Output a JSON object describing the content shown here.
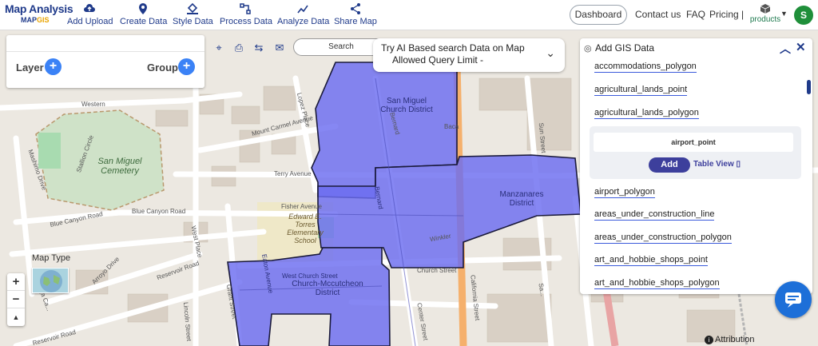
{
  "app": {
    "logo_main": "Map Analysis",
    "logo_sub_a": "MAP",
    "logo_sub_b": "GIS"
  },
  "nav": [
    {
      "label": "Add Upload",
      "icon": "upload-cloud-icon"
    },
    {
      "label": "Create Data",
      "icon": "map-pin-icon"
    },
    {
      "label": "Style Data",
      "icon": "paint-bucket-icon"
    },
    {
      "label": "Process Data",
      "icon": "process-icon"
    },
    {
      "label": "Analyze Data",
      "icon": "analyze-icon"
    },
    {
      "label": "Share Map",
      "icon": "share-icon"
    }
  ],
  "header_right": {
    "dashboard": "Dashboard",
    "contact": "Contact us",
    "faq": "FAQ",
    "pricing": "Pricing |",
    "products": "products",
    "avatar": "S"
  },
  "layer_panel": {
    "layer": "Layer",
    "group": "Group"
  },
  "search": {
    "label": "Search"
  },
  "ai_search": {
    "line1": "Try AI Based search Data on Map",
    "line2": "Allowed Query Limit -"
  },
  "gis_panel": {
    "title": "Add GIS Data",
    "items_top": [
      "accommodations_polygon",
      "agricultural_lands_point",
      "agricultural_lands_polygon"
    ],
    "selected": {
      "name": "airport_point",
      "add": "Add",
      "table_view": "Table View"
    },
    "items_bottom": [
      "airport_polygon",
      "areas_under_construction_line",
      "areas_under_construction_polygon",
      "art_and_hobbie_shops_point",
      "art_and_hobbie_shops_polygon"
    ]
  },
  "map": {
    "map_type": "Map Type",
    "attribution": "Attribution",
    "zoom_in": "+",
    "zoom_out": "−",
    "reset": "▲",
    "streets": [
      "Western",
      "Stallion Circle",
      "Mashimo Drive",
      "Terry Avenue",
      "Fisher Avenue",
      "Blue Canyon Road",
      "Blue Canyon Road",
      "West Place",
      "Reservoir Road",
      "Arroyo Drive",
      "Grant Street",
      "Lincoln Street",
      "Reservoir Road",
      "Mount Carmel Avenue",
      "Lopez Place",
      "Bernard",
      "Baca",
      "Sun Street",
      "Winkler",
      "California Street",
      "Church Street",
      "West Church Street",
      "Eaton Avenue",
      "Bernard",
      "Center Street",
      "Baja Ca...",
      "Sa..."
    ],
    "places": [
      "San Miguel Cemetery",
      "Edward E. Torres Elementary School"
    ],
    "districts": [
      {
        "line1": "San Miguel",
        "line2": "Church District"
      },
      {
        "line1": "Manzanares",
        "line2": "District"
      },
      {
        "line1": "West Church Street",
        "line2": "Church-Mccutcheon",
        "line3": "District"
      }
    ]
  },
  "colors": {
    "brand": "#1f3a8a",
    "district_fill": "#6b6cf0",
    "accent_button": "#3b82f6",
    "add_button": "#3d3f9c",
    "avatar": "#1f8f3a"
  }
}
